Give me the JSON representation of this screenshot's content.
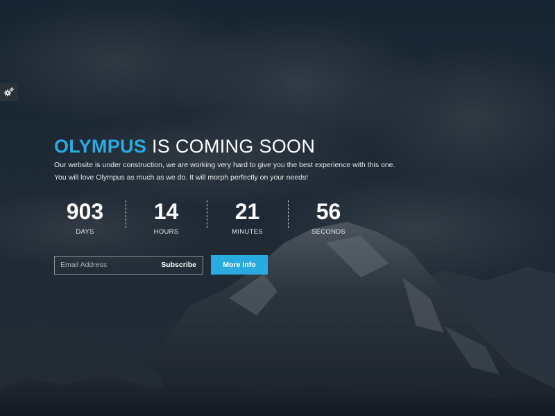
{
  "hero": {
    "brand": "OLYMPUS",
    "headline_rest": " IS COMING SOON",
    "description_line1": "Our website is under construction, we are working very hard to give you the best experience with this one.",
    "description_line2": "You will love Olympus as much as we do. It will morph perfectly on your needs!"
  },
  "countdown": {
    "days": {
      "value": "903",
      "label": "DAYS"
    },
    "hours": {
      "value": "14",
      "label": "HOURS"
    },
    "minutes": {
      "value": "21",
      "label": "MINUTES"
    },
    "seconds": {
      "value": "56",
      "label": "SECONDS"
    }
  },
  "subscribe": {
    "placeholder": "Email Address",
    "button_label": "Subscribe"
  },
  "more_info": {
    "button_label": "More Info"
  },
  "settings": {
    "icon": "gears-icon"
  },
  "colors": {
    "accent": "#29abe2",
    "background": "#1c2733"
  }
}
